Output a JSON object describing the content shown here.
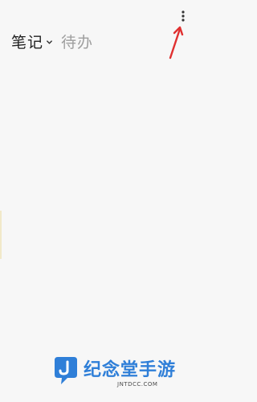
{
  "tabs": {
    "notes": "笔记",
    "todo": "待办"
  },
  "toolbar": {
    "more_icon": "vertical-ellipsis-icon"
  },
  "annotation": {
    "arrow_color": "#e03030"
  },
  "watermark": {
    "title": "纪念堂手游",
    "subtitle": "JNTDCC.COM"
  },
  "colors": {
    "background": "#f7f7f7",
    "active_tab": "#222222",
    "inactive_tab": "#9e9e9e",
    "watermark_blue": "#2f7fd8"
  }
}
